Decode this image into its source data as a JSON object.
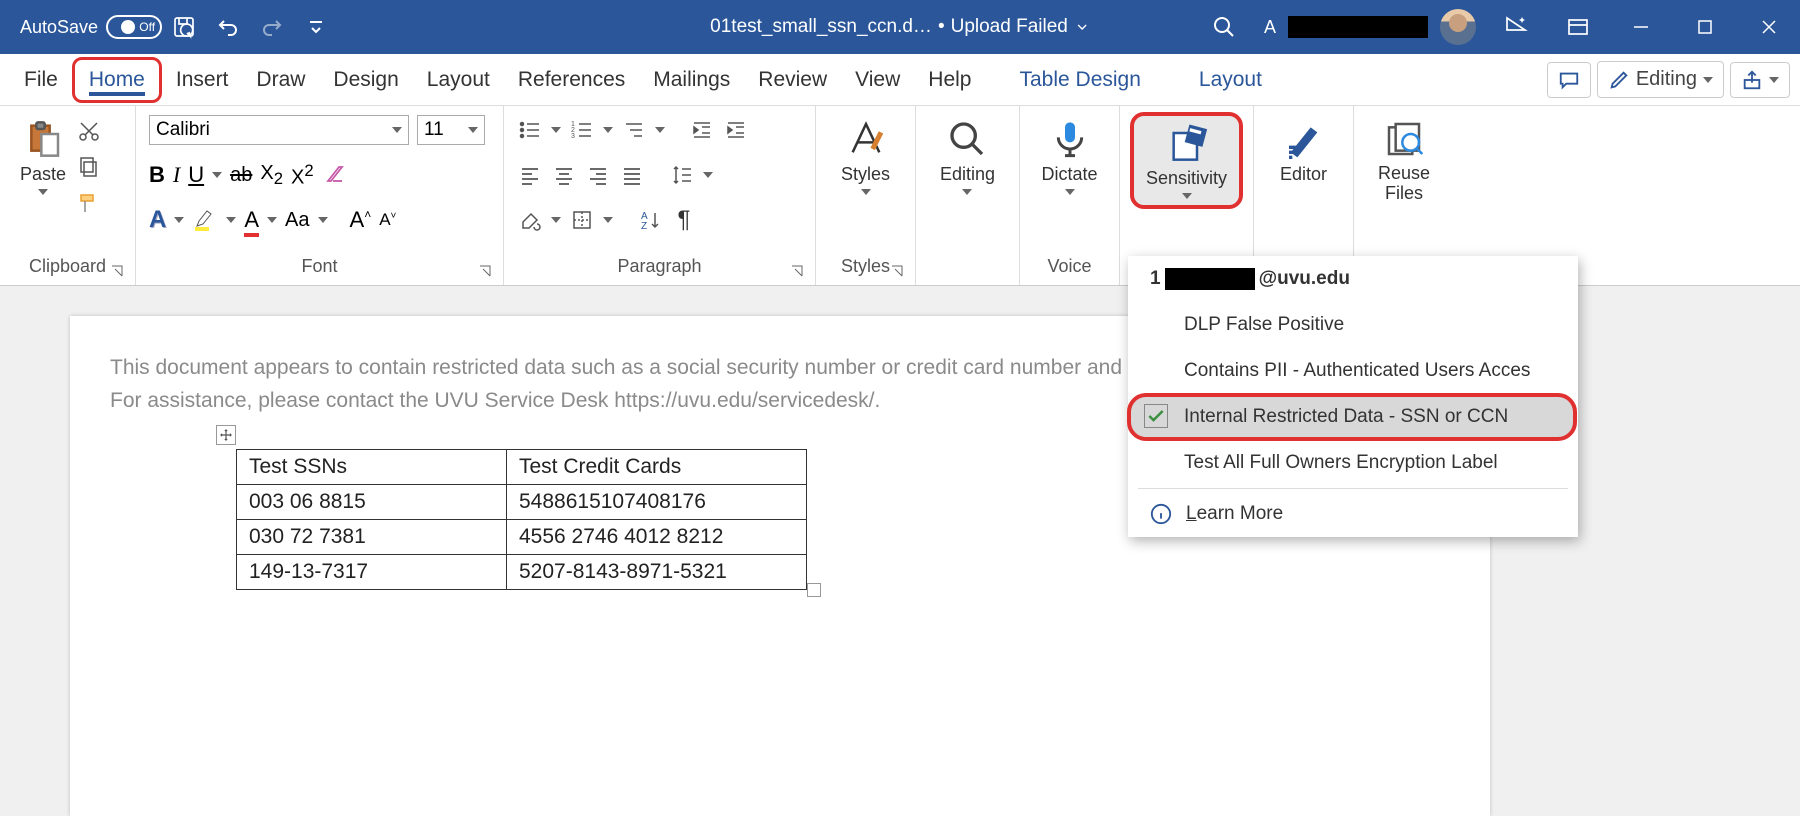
{
  "titlebar": {
    "autosave_label": "AutoSave",
    "autosave_state": "Off",
    "document_name": "01test_small_ssn_ccn.d…",
    "upload_status": "Upload Failed",
    "user_initial": "A"
  },
  "tabs": {
    "file": "File",
    "home": "Home",
    "insert": "Insert",
    "draw": "Draw",
    "design": "Design",
    "layout": "Layout",
    "references": "References",
    "mailings": "Mailings",
    "review": "Review",
    "view": "View",
    "help": "Help",
    "table_design": "Table Design",
    "table_layout": "Layout",
    "editing_mode": "Editing"
  },
  "ribbon": {
    "clipboard": {
      "paste": "Paste",
      "group": "Clipboard"
    },
    "font": {
      "name": "Calibri",
      "size": "11",
      "group": "Font",
      "sample": "Aa"
    },
    "paragraph": {
      "group": "Paragraph"
    },
    "styles": {
      "button": "Styles",
      "group": "Styles"
    },
    "editing": {
      "button": "Editing"
    },
    "voice": {
      "dictate": "Dictate",
      "group": "Voice"
    },
    "sensitivity": {
      "button": "Sensitivity"
    },
    "editor": {
      "button": "Editor"
    },
    "reuse": {
      "button": "Reuse Files"
    }
  },
  "document": {
    "policy_text": "This document appears to contain restricted data such as a social security number or credit card number and has been encrypted for security. For assistance, please contact the UVU Service Desk https://uvu.edu/servicedesk/.",
    "table": {
      "headers": [
        "Test SSNs",
        "Test Credit Cards"
      ],
      "rows": [
        [
          "003 06 8815",
          "5488615107408176"
        ],
        [
          "030 72 7381",
          "4556 2746 4012 8212"
        ],
        [
          "149-13-7317",
          "5207-8143-8971-5321"
        ]
      ]
    }
  },
  "sensitivity_menu": {
    "user": "@uvu.edu",
    "user_prefix": "1",
    "items": [
      "DLP False Positive",
      "Contains PII - Authenticated Users Acces",
      "Internal Restricted Data - SSN or CCN",
      "Test All Full Owners Encryption Label"
    ],
    "learn_more": "Learn More"
  }
}
